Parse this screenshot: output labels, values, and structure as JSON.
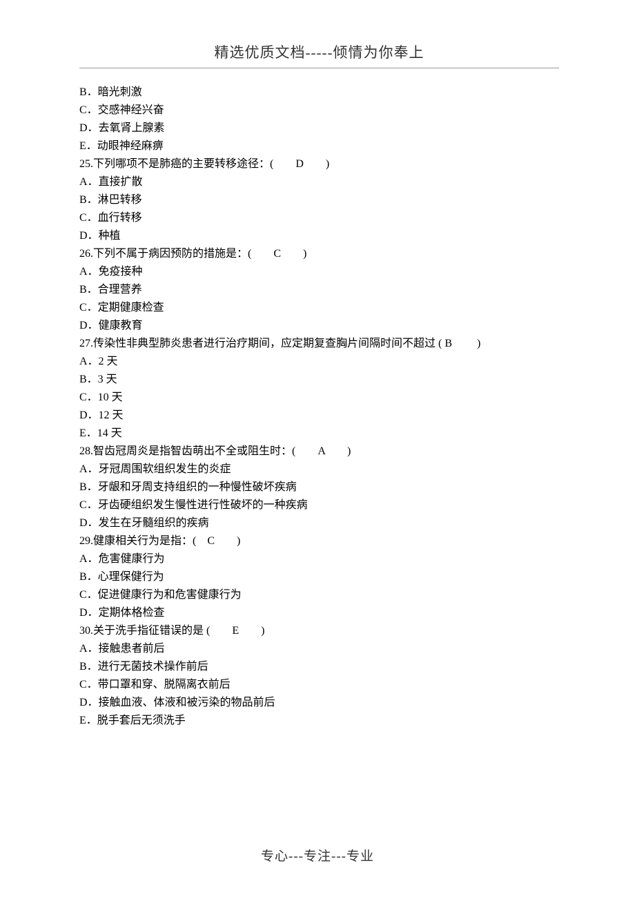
{
  "header": "精选优质文档-----倾情为你奉上",
  "footer": "专心---专注---专业",
  "lines": [
    "B．暗光刺激",
    "C．交感神经兴奋",
    "D．去氧肾上腺素",
    "E．动眼神经麻痹",
    "25.下列哪项不是肺癌的主要转移途径：(　　D　　)",
    "A．直接扩散",
    "B．淋巴转移",
    "C．血行转移",
    "D．种植",
    "26.下列不属于病因预防的措施是：(　　C　　)",
    "A．免疫接种",
    "B．合理营养",
    "C．定期健康检查",
    "D．健康教育",
    "27.传染性非典型肺炎患者进行治疗期间，应定期复查胸片间隔时间不超过 ( B　　 )",
    "A．2 天",
    "B．3 天",
    "C．10 天",
    "D．12 天",
    "E．14 天",
    "28.智齿冠周炎是指智齿萌出不全或阻生时：(　　A　　)",
    "A．牙冠周围软组织发生的炎症",
    "B．牙龈和牙周支持组织的一种慢性破坏疾病",
    "C．牙齿硬组织发生慢性进行性破坏的一种疾病",
    "D．发生在牙髓组织的疾病",
    "29.健康相关行为是指：(　C　　)",
    "A．危害健康行为",
    "B．心理保健行为",
    "C．促进健康行为和危害健康行为",
    "D．定期体格检查",
    "30.关于洗手指征错误的是 (　　E　　)",
    "A．接触患者前后",
    "B．进行无菌技术操作前后",
    "C．带口罩和穿、脱隔离衣前后",
    "D．接触血液、体液和被污染的物品前后",
    "E．脱手套后无须洗手"
  ]
}
